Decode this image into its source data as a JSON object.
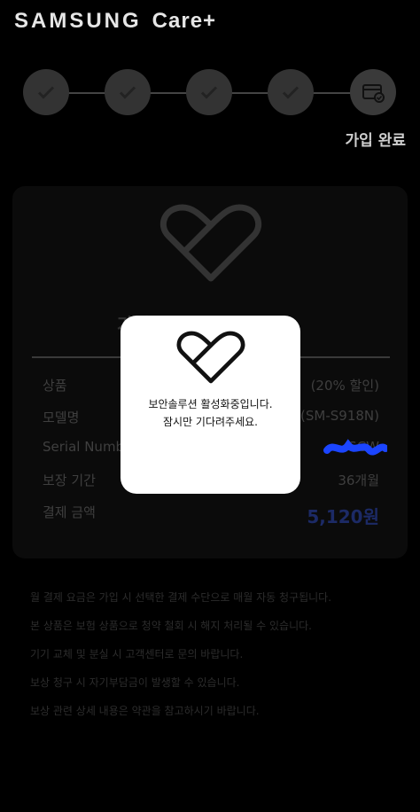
{
  "header": {
    "brand": "SAMSUNG",
    "product": "Care+"
  },
  "steps": {
    "current_label": "가입 완료",
    "completed_count": 4,
    "total": 5
  },
  "card": {
    "title": "가입이 완료되었습니다.",
    "rows": [
      {
        "label": "상품",
        "value": "(20% 할인)"
      },
      {
        "label": "모델명",
        "value": "(SM-S918N)"
      },
      {
        "label": "Serial Number",
        "value": "SCW"
      },
      {
        "label": "보장 기간",
        "value": "36개월"
      },
      {
        "label": "결제 금액",
        "value": "5,120원"
      }
    ]
  },
  "notes": [
    "월 결제 요금은 가입 시 선택한 결제 수단으로 매월 자동 청구됩니다.",
    "본 상품은 보험 상품으로 청약 철회 시 해지 처리될 수 있습니다.",
    "기기 교체 및 분실 시 고객센터로 문의 바랍니다.",
    "보상 청구 시 자기부담금이 발생할 수 있습니다.",
    "보상 관련 상세 내용은 약관을 참고하시기 바랍니다."
  ],
  "modal": {
    "line1": "보안솔루션 활성화중입니다.",
    "line2": "잠시만 기다려주세요."
  },
  "colors": {
    "background": "#000000",
    "step": "#333333",
    "modal": "#ffffff",
    "amount": "#1c2a66",
    "scribble": "#1b45ff"
  }
}
